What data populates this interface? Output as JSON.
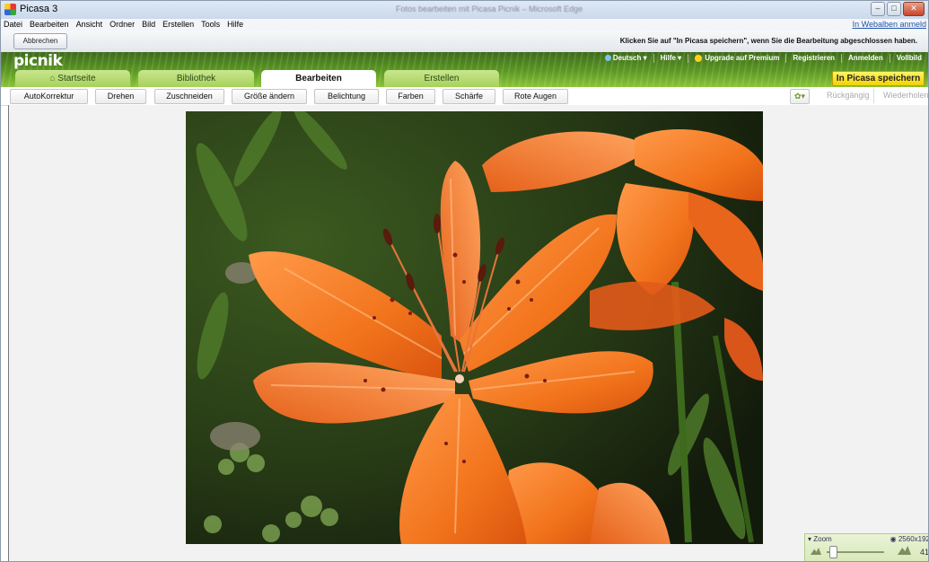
{
  "window": {
    "title": "Picasa 3",
    "subtitle": "Fotos bearbeiten mit Picasa Picnik – Microsoft Edge"
  },
  "menubar": {
    "items": [
      "Datei",
      "Bearbeiten",
      "Ansicht",
      "Ordner",
      "Bild",
      "Erstellen",
      "Tools",
      "Hilfe"
    ],
    "right_link": "In Webalben anmeld"
  },
  "picasa_toolbar": {
    "cancel_label": "Abbrechen",
    "hint": "Klicken Sie auf \"In Picasa speichern\", wenn Sie die Bearbeitung abgeschlossen haben."
  },
  "picnik": {
    "logo": "picnik",
    "top_links": [
      "Deutsch ▾",
      "Hilfe ▾",
      "Upgrade auf Premium",
      "Registrieren",
      "Anmelden",
      "Vollbild"
    ],
    "tabs": [
      "Startseite",
      "Bibliothek",
      "Bearbeiten",
      "Erstellen"
    ],
    "active_tab": "Bearbeiten",
    "save_button": "In Picasa speichern"
  },
  "edit_tools": {
    "buttons": [
      "AutoKorrektur",
      "Drehen",
      "Zuschneiden",
      "Größe ändern",
      "Belichtung",
      "Farben",
      "Schärfe",
      "Rote Augen"
    ],
    "undo": "Rückgängig",
    "redo": "Wiederholen",
    "gear": "✿▾"
  },
  "zoom": {
    "label": "▾ Zoom",
    "resolution": "2560x192",
    "percent": "41"
  },
  "colors": {
    "accent_green": "#8ac43a",
    "save_yellow": "#f3d300",
    "lily_orange": "#f2741c"
  }
}
